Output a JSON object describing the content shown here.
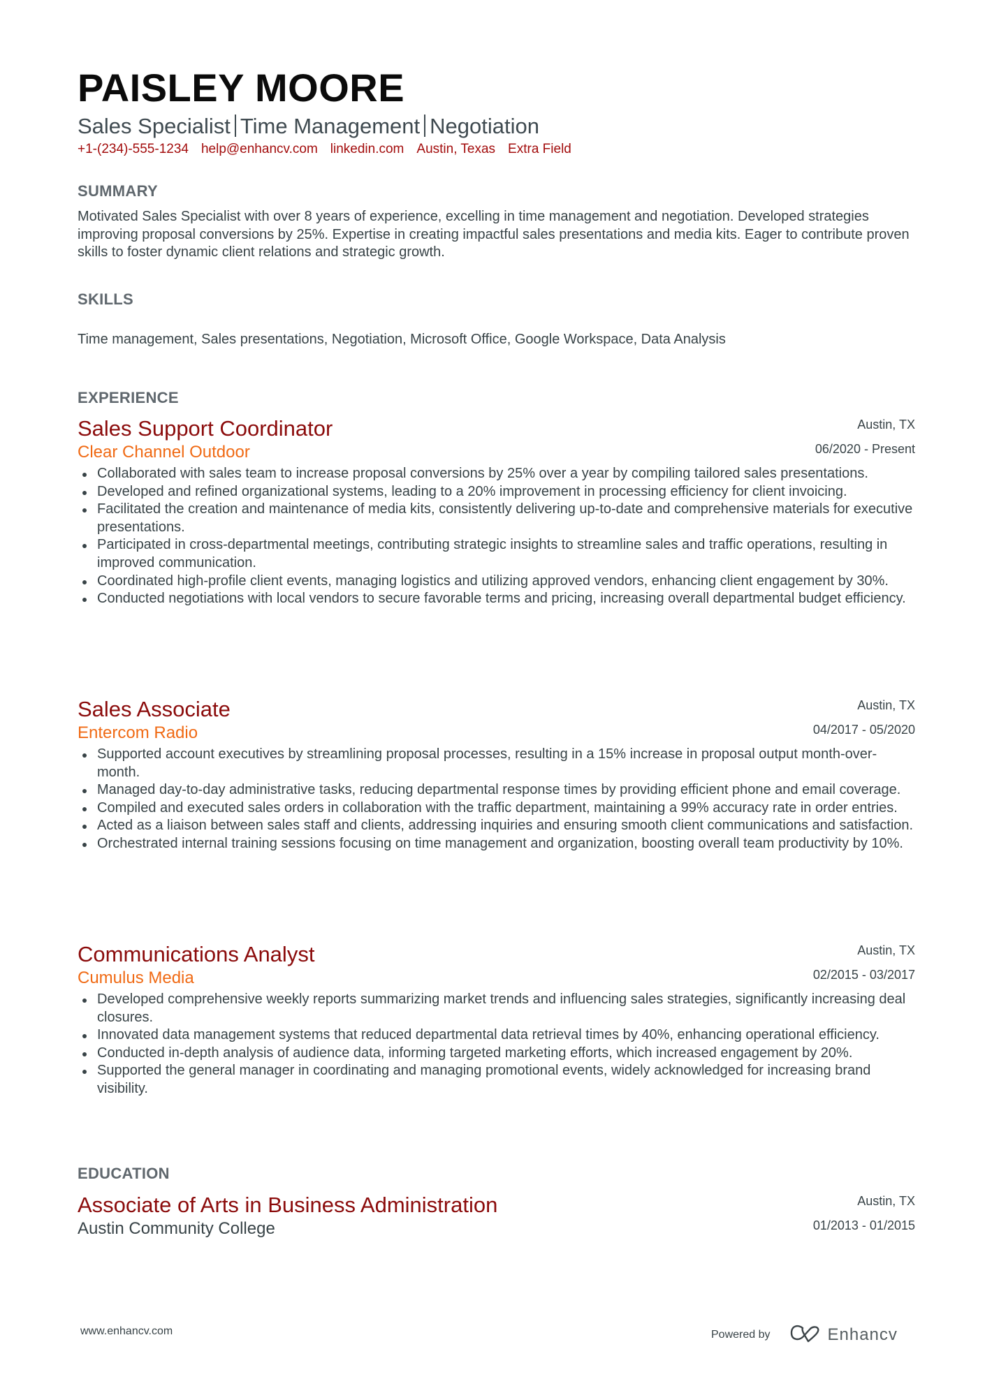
{
  "header": {
    "name": "PAISLEY MOORE",
    "subtitle_parts": [
      "Sales Specialist",
      "Time Management",
      "Negotiation"
    ],
    "contact": [
      "+1-(234)-555-1234",
      "help@enhancv.com",
      "linkedin.com",
      "Austin, Texas",
      "Extra Field"
    ]
  },
  "summary": {
    "title": "SUMMARY",
    "text": "Motivated Sales Specialist with over 8 years of experience, excelling in time management and negotiation. Developed strategies improving proposal conversions by 25%. Expertise in creating impactful sales presentations and media kits. Eager to contribute proven skills to foster dynamic client relations and strategic growth."
  },
  "skills": {
    "title": "SKILLS",
    "text": "Time management, Sales presentations, Negotiation, Microsoft Office, Google Workspace, Data Analysis"
  },
  "experience": {
    "title": "EXPERIENCE",
    "jobs": [
      {
        "title": "Sales Support Coordinator",
        "company": "Clear Channel Outdoor",
        "location": "Austin, TX",
        "dates": "06/2020 - Present",
        "bullets": [
          "Collaborated with sales team to increase proposal conversions by 25% over a year by compiling tailored sales presentations.",
          "Developed and refined organizational systems, leading to a 20% improvement in processing efficiency for client invoicing.",
          "Facilitated the creation and maintenance of media kits, consistently delivering up-to-date and comprehensive materials for executive presentations.",
          "Participated in cross-departmental meetings, contributing strategic insights to streamline sales and traffic operations, resulting in improved communication.",
          "Coordinated high-profile client events, managing logistics and utilizing approved vendors, enhancing client engagement by 30%.",
          "Conducted negotiations with local vendors to secure favorable terms and pricing, increasing overall departmental budget efficiency."
        ]
      },
      {
        "title": "Sales Associate",
        "company": "Entercom Radio",
        "location": "Austin, TX",
        "dates": "04/2017 - 05/2020",
        "bullets": [
          "Supported account executives by streamlining proposal processes, resulting in a 15% increase in proposal output month-over-month.",
          "Managed day-to-day administrative tasks, reducing departmental response times by providing efficient phone and email coverage.",
          "Compiled and executed sales orders in collaboration with the traffic department, maintaining a 99% accuracy rate in order entries.",
          "Acted as a liaison between sales staff and clients, addressing inquiries and ensuring smooth client communications and satisfaction.",
          "Orchestrated internal training sessions focusing on time management and organization, boosting overall team productivity by 10%."
        ]
      },
      {
        "title": "Communications Analyst",
        "company": "Cumulus Media",
        "location": "Austin, TX",
        "dates": "02/2015 - 03/2017",
        "bullets": [
          "Developed comprehensive weekly reports summarizing market trends and influencing sales strategies, significantly increasing deal closures.",
          "Innovated data management systems that reduced departmental data retrieval times by 40%, enhancing operational efficiency.",
          "Conducted in-depth analysis of audience data, informing targeted marketing efforts, which increased engagement by 20%.",
          "Supported the general manager in coordinating and managing promotional events, widely acknowledged for increasing brand visibility."
        ]
      }
    ]
  },
  "education": {
    "title": "EDUCATION",
    "items": [
      {
        "degree": "Associate of Arts in Business Administration",
        "school": "Austin Community College",
        "location": "Austin, TX",
        "dates": "01/2013 - 01/2015"
      }
    ]
  },
  "footer": {
    "url": "www.enhancv.com",
    "powered_by": "Powered by",
    "brand": "Enhancv"
  },
  "colors": {
    "title_red": "#8b0b0b",
    "company_orange": "#f06a14",
    "contact_red": "#a30d0d",
    "heading_gray": "#5f676d",
    "body_text": "#384347"
  }
}
